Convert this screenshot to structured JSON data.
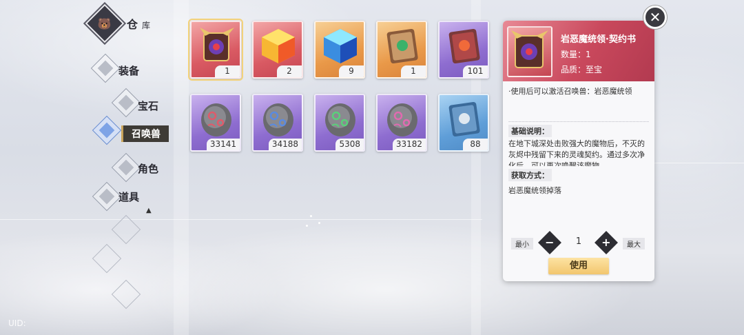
{
  "sidebar": {
    "title": "仓",
    "subtitle": "库",
    "items": [
      {
        "label": "装备"
      },
      {
        "label": "宝石"
      },
      {
        "label": "召唤兽"
      },
      {
        "label": "角色"
      },
      {
        "label": "道具"
      }
    ],
    "active_item": "召唤兽"
  },
  "grid": {
    "items": [
      {
        "count": "1",
        "rarity": "red",
        "icon": "demon-contract-book-icon",
        "selected": true
      },
      {
        "count": "2",
        "rarity": "red",
        "icon": "orange-crystal-cube-icon"
      },
      {
        "count": "9",
        "rarity": "orange",
        "icon": "blue-crystal-cube-icon"
      },
      {
        "count": "1",
        "rarity": "orange",
        "icon": "green-gem-book-icon"
      },
      {
        "count": "101",
        "rarity": "purple",
        "icon": "red-gem-book-icon"
      },
      {
        "count": "33141",
        "rarity": "purple",
        "icon": "red-rune-stone-icon"
      },
      {
        "count": "34188",
        "rarity": "purple",
        "icon": "blue-rune-stone-icon"
      },
      {
        "count": "5308",
        "rarity": "purple",
        "icon": "green-rune-stone-icon"
      },
      {
        "count": "33182",
        "rarity": "purple",
        "icon": "pink-rune-stone-icon"
      },
      {
        "count": "88",
        "rarity": "blue",
        "icon": "blue-tome-icon"
      }
    ]
  },
  "detail": {
    "name": "岩恶魔统领·契约书",
    "quantity_label": "数量：1",
    "quality_label": "品质：至宝",
    "effect": "·使用后可以激活召唤兽：岩恶魔统领",
    "basic_heading": "基础说明：",
    "basic_text": "在地下城深处击败强大的魔物后，不灭的灰烬中残留下来的灵魂契约。通过多次净化后，可以再次唤醒该魔物",
    "source_heading": "获取方式：",
    "source_text": "岩恶魔统领掉落",
    "min_label": "最小",
    "max_label": "最大",
    "qty_value": "1",
    "minus_symbol": "−",
    "plus_symbol": "+",
    "use_label": "使用"
  },
  "close_symbol": "✕",
  "uid_label": "UID:",
  "colors": {
    "rarity_red": "#d95a63",
    "rarity_orange": "#e99949",
    "rarity_purple": "#8e6dd0",
    "rarity_blue": "#5f9ed8",
    "use_button": "#f2c66e",
    "header_red": "#c9485c"
  }
}
